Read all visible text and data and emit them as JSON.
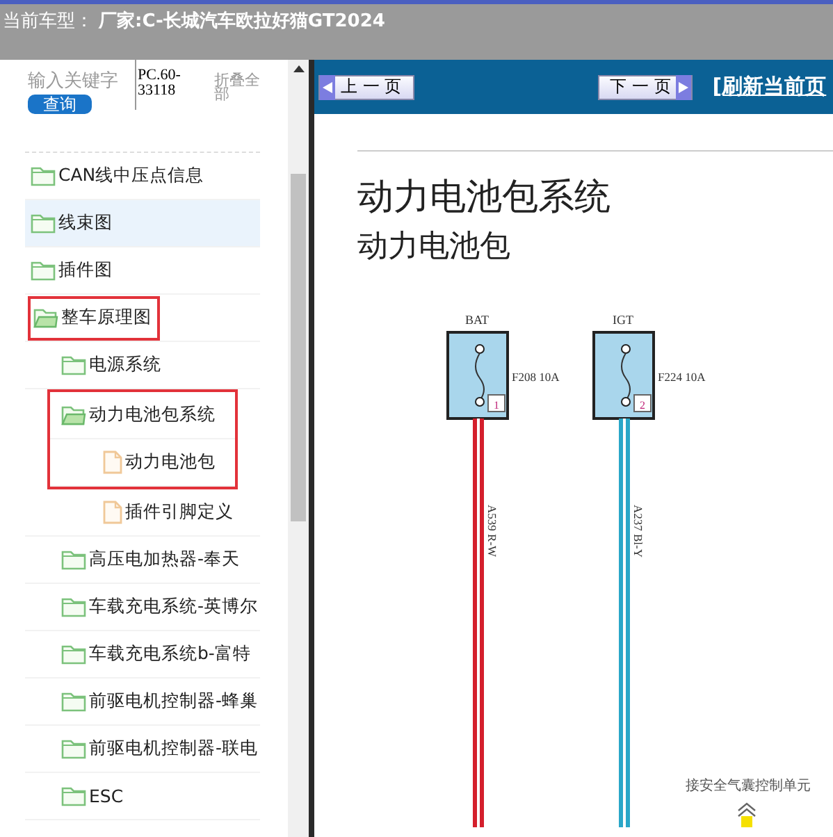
{
  "header": {
    "label": "当前车型：",
    "value": "厂家:C-长城汽车欧拉好猫GT2024"
  },
  "sidebar": {
    "search": {
      "placeholder": "输入关键字"
    },
    "search_button": "查询",
    "code": "PC.60-33118",
    "collapse_link": "折叠全部",
    "tree": [
      {
        "label": "CAN线中压点信息",
        "kind": "folder",
        "expanded": false,
        "selected": false,
        "boxed": false
      },
      {
        "label": "线束图",
        "kind": "folder",
        "expanded": false,
        "selected": true,
        "boxed": false
      },
      {
        "label": "插件图",
        "kind": "folder",
        "expanded": false,
        "selected": false,
        "boxed": false
      },
      {
        "label": "整车原理图",
        "kind": "folder",
        "expanded": true,
        "selected": false,
        "boxed": true,
        "children": [
          {
            "label": "电源系统",
            "kind": "folder",
            "expanded": false,
            "selected": false,
            "boxed": false
          },
          {
            "label": "动力电池包系统",
            "kind": "folder",
            "expanded": true,
            "selected": false,
            "boxed": true,
            "children": [
              {
                "label": "动力电池包",
                "kind": "file",
                "selected": false,
                "boxed": true
              },
              {
                "label": "插件引脚定义",
                "kind": "file",
                "selected": false,
                "boxed": false
              }
            ]
          },
          {
            "label": "高压电加热器-奉天",
            "kind": "folder",
            "expanded": false,
            "selected": false,
            "boxed": false
          },
          {
            "label": "车载充电系统-英博尔",
            "kind": "folder",
            "expanded": false,
            "selected": false,
            "boxed": false
          },
          {
            "label": "车载充电系统b-富特",
            "kind": "folder",
            "expanded": false,
            "selected": false,
            "boxed": false
          },
          {
            "label": "前驱电机控制器-蜂巢",
            "kind": "folder",
            "expanded": false,
            "selected": false,
            "boxed": false
          },
          {
            "label": "前驱电机控制器-联电",
            "kind": "folder",
            "expanded": false,
            "selected": false,
            "boxed": false
          },
          {
            "label": "ESC",
            "kind": "folder",
            "expanded": false,
            "selected": false,
            "boxed": false
          }
        ]
      }
    ]
  },
  "toolbar": {
    "prev_button": "上 一 页",
    "next_button": "下 一 页",
    "refresh_link": "[刷新当前页"
  },
  "document": {
    "title": "动力电池包系统",
    "subtitle": "动力电池包",
    "fuses": [
      {
        "name": "BAT",
        "fuse": "F208 10A",
        "pin": "1",
        "wire": "A539 R-W",
        "color": "#d41f2c"
      },
      {
        "name": "IGT",
        "fuse": "F224 10A",
        "pin": "2",
        "wire": "A237 Bl-Y",
        "color": "#2aa7c8"
      }
    ],
    "destination_label": "接安全气囊控制单元"
  }
}
